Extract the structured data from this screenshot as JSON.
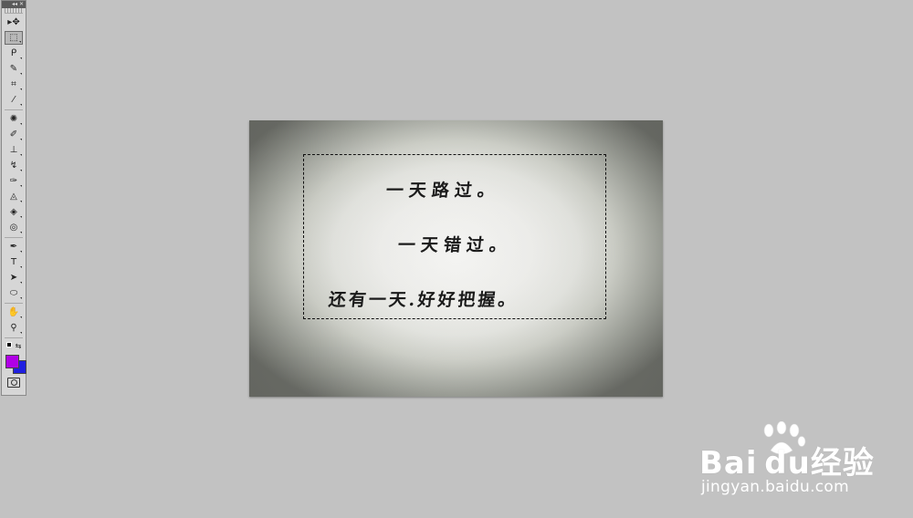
{
  "toolbar": {
    "header_icons": [
      "collapse-icon",
      "close-icon"
    ],
    "tools": [
      {
        "name": "move-tool",
        "glyph": "▸✥",
        "active": false
      },
      {
        "name": "marquee-tool",
        "glyph": "⬚",
        "active": true
      },
      {
        "name": "lasso-tool",
        "glyph": "ᑭ",
        "active": false
      },
      {
        "name": "quick-select-tool",
        "glyph": "✎",
        "active": false
      },
      {
        "name": "crop-tool",
        "glyph": "⌗",
        "active": false
      },
      {
        "name": "eyedropper-tool",
        "glyph": "⁄",
        "active": false
      },
      {
        "name": "spot-heal-tool",
        "glyph": "✺",
        "active": false
      },
      {
        "name": "brush-tool",
        "glyph": "✐",
        "active": false
      },
      {
        "name": "clone-stamp-tool",
        "glyph": "⊥",
        "active": false
      },
      {
        "name": "history-brush-tool",
        "glyph": "↯",
        "active": false
      },
      {
        "name": "eraser-tool",
        "glyph": "✑",
        "active": false
      },
      {
        "name": "paint-bucket-tool",
        "glyph": "◬",
        "active": false
      },
      {
        "name": "blur-tool",
        "glyph": "◈",
        "active": false
      },
      {
        "name": "dodge-tool",
        "glyph": "◎",
        "active": false
      },
      {
        "name": "pen-tool",
        "glyph": "✒",
        "active": false
      },
      {
        "name": "type-tool",
        "glyph": "T",
        "active": false
      },
      {
        "name": "path-select-tool",
        "glyph": "➤",
        "active": false
      },
      {
        "name": "shape-tool",
        "glyph": "⬭",
        "active": false
      },
      {
        "name": "hand-tool",
        "glyph": "✋",
        "active": false
      },
      {
        "name": "zoom-tool",
        "glyph": "⚲",
        "active": false
      }
    ],
    "foreground_color": "#b000e6",
    "background_color": "#1f1fe0",
    "swap_icon": "swap-colors-icon",
    "default_colors_icon": "default-colors-icon",
    "quick_mask_icon": "quick-mask-icon"
  },
  "document": {
    "lines": [
      "一天路过。",
      "一天错过。",
      "还有一天.好好把握。"
    ]
  },
  "watermark": {
    "brand": "Bai du经验",
    "url": "jingyan.baidu.com"
  }
}
